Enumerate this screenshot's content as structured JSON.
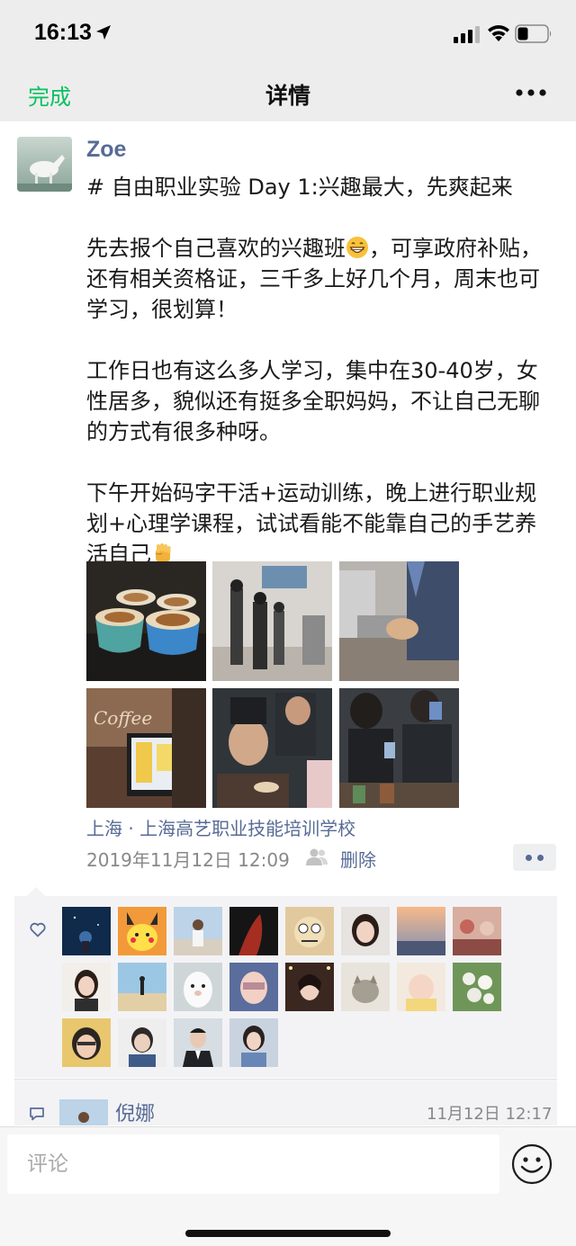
{
  "status_bar": {
    "time": "16:13"
  },
  "nav": {
    "done_label": "完成",
    "title": "详情"
  },
  "post": {
    "author": "Zoe",
    "paragraphs": [
      "# 自由职业实验 Day 1:兴趣最大，先爽起来",
      "先去报个自己喜欢的兴趣班",
      "，可享政府补贴，还有相关资格证，三千多上好几个月，周末也可学习，很划算！",
      "工作日也有这么多人学习，集中在30-40岁，女性居多，貌似还有挺多全职妈妈，不让自己无聊的方式有很多种呀。",
      "下午开始码字干活+运动训练，晚上进行职业规划+心理学课程，试试看能不能靠自己的手艺养活自己"
    ],
    "location": "上海 · 上海高艺职业技能培训学校",
    "timestamp": "2019年11月12日 12:09",
    "delete_label": "删除",
    "emoji": [
      "grinning-face",
      "raised-fist"
    ]
  },
  "likes": {
    "count_avatars": 20
  },
  "comments": [
    {
      "name": "倪娜",
      "time": "11月12日 12:17"
    }
  ],
  "comment_input": {
    "placeholder": "评论"
  },
  "colors": {
    "link_blue": "#576b95",
    "accent_green": "#07c160",
    "panel_bg": "#f3f3f5",
    "nav_bg": "#ededed"
  }
}
